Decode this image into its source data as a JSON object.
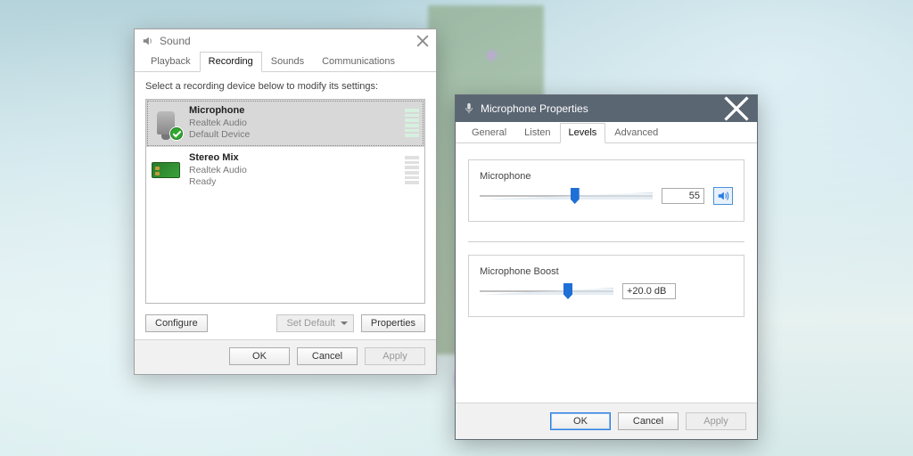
{
  "sound": {
    "title": "Sound",
    "tabs": [
      "Playback",
      "Recording",
      "Sounds",
      "Communications"
    ],
    "active_tab": 1,
    "instruction": "Select a recording device below to modify its settings:",
    "devices": [
      {
        "name": "Microphone",
        "desc": "Realtek Audio",
        "status": "Default Device",
        "icon": "mic",
        "selected": true,
        "default": true
      },
      {
        "name": "Stereo Mix",
        "desc": "Realtek Audio",
        "status": "Ready",
        "icon": "card",
        "selected": false,
        "default": false
      }
    ],
    "buttons": {
      "configure": "Configure",
      "set_default": "Set Default",
      "properties": "Properties",
      "ok": "OK",
      "cancel": "Cancel",
      "apply": "Apply"
    }
  },
  "props": {
    "title": "Microphone Properties",
    "tabs": [
      "General",
      "Listen",
      "Levels",
      "Advanced"
    ],
    "active_tab": 2,
    "mic": {
      "label": "Microphone",
      "value": "55",
      "percent": 55
    },
    "boost": {
      "label": "Microphone Boost",
      "value": "+20.0 dB",
      "percent": 66
    },
    "buttons": {
      "ok": "OK",
      "cancel": "Cancel",
      "apply": "Apply"
    }
  }
}
